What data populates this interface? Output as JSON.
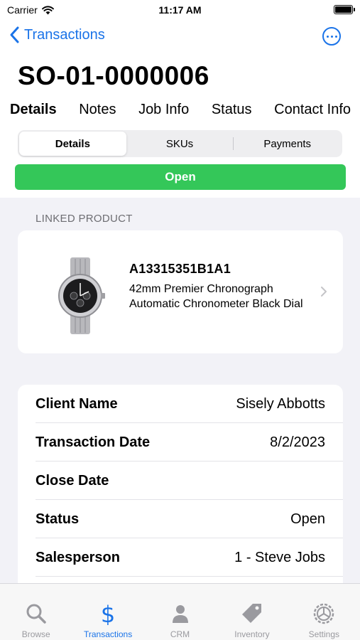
{
  "status_bar": {
    "carrier": "Carrier",
    "time": "11:17 AM"
  },
  "nav": {
    "back_label": "Transactions"
  },
  "title": "SO-01-0000006",
  "tabs": [
    {
      "label": "Details",
      "active": true
    },
    {
      "label": "Notes"
    },
    {
      "label": "Job Info"
    },
    {
      "label": "Status"
    },
    {
      "label": "Contact Info"
    }
  ],
  "segments": [
    {
      "label": "Details",
      "active": true
    },
    {
      "label": "SKUs"
    },
    {
      "label": "Payments"
    }
  ],
  "status_banner": {
    "label": "Open",
    "color": "#34c759"
  },
  "linked_product": {
    "header": "LINKED PRODUCT",
    "sku": "A13315351B1A1",
    "description": "42mm Premier Chronograph Automatic Chronometer Black Dial"
  },
  "details": [
    {
      "label": "Client Name",
      "value": "Sisely Abbotts"
    },
    {
      "label": "Transaction Date",
      "value": "8/2/2023"
    },
    {
      "label": "Close Date",
      "value": ""
    },
    {
      "label": "Status",
      "value": "Open"
    },
    {
      "label": "Salesperson",
      "value": "1 - Steve Jobs"
    }
  ],
  "tab_bar": [
    {
      "label": "Browse",
      "icon": "magnifier-icon"
    },
    {
      "label": "Transactions",
      "icon": "dollar-icon",
      "active": true
    },
    {
      "label": "CRM",
      "icon": "person-icon"
    },
    {
      "label": "Inventory",
      "icon": "tag-icon"
    },
    {
      "label": "Settings",
      "icon": "gear-icon"
    }
  ],
  "colors": {
    "accent": "#1a73e8",
    "success": "#34c759",
    "background": "#f2f2f7"
  }
}
